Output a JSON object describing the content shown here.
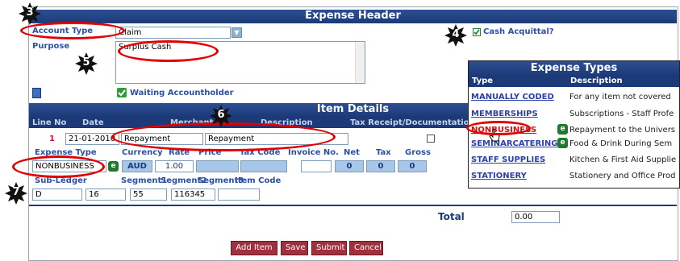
{
  "expense_header": {
    "title": "Expense Header",
    "account_type_label": "Account Type",
    "account_type_value": "Claim",
    "purpose_label": "Purpose",
    "purpose_value": "Surplus Cash",
    "cash_acquittal_label": "Cash Acquittal?",
    "status": "Waiting Accountholder"
  },
  "item_details": {
    "title": "Item Details",
    "columns": [
      "Line No",
      "Date",
      "Merchant",
      "Description",
      "Tax Receipt/Documentation"
    ],
    "row": {
      "line_no": "1",
      "date": "21-01-2010",
      "merchant": "Repayment",
      "description": "Repayment"
    },
    "sub_columns": [
      "Expense Type",
      "Currency",
      "Rate",
      "Price",
      "Tax Code",
      "Invoice No.",
      "Net",
      "Tax",
      "Gross"
    ],
    "expense_type_value": "NONBUSINESS",
    "currency_value": "AUD",
    "rate_value": "1.00",
    "net_value": "0",
    "tax_value": "0",
    "gross_value": "0",
    "sub_ledger_labels": [
      "Sub-Ledger",
      "Segment1",
      "Segment2",
      "Segment3",
      "Item Code"
    ],
    "sub_ledger_values": [
      "D",
      "16",
      "55",
      "116345",
      ""
    ]
  },
  "total": {
    "label": "Total",
    "value": "0.00"
  },
  "buttons": {
    "add_item": "Add Item",
    "save": "Save",
    "submit": "Submit",
    "cancel": "Cancel"
  },
  "expense_types_popup": {
    "title": "Expense Types",
    "col_type": "Type",
    "col_description": "Description",
    "rows": [
      {
        "type": "MANUALLY CODED",
        "description": "For any item not covered"
      },
      {
        "type": "MEMBERSHIPS",
        "description": "Subscriptions - Staff Profe"
      },
      {
        "type": "NONBUSINESS",
        "description": "Repayment to the Univers"
      },
      {
        "type": "SEMINARCATERING",
        "description": "Food & Drink During Sem"
      },
      {
        "type": "STAFF SUPPLIES",
        "description": "Kitchen & First Aid Supplie"
      },
      {
        "type": "STATIONERY",
        "description": "Stationery and Office Prod"
      }
    ]
  },
  "callouts": [
    "3",
    "4",
    "5",
    "6",
    "7"
  ],
  "glyphs": {
    "e_button": "e",
    "dropdown_arrow": "▼",
    "checkmark": "✔"
  },
  "colors": {
    "header_blue": "#1c3a78",
    "label_blue": "#2c50a8",
    "highlight_red": "#e10000",
    "button_red": "#a0303e",
    "status_green": "#2f9e3a"
  }
}
